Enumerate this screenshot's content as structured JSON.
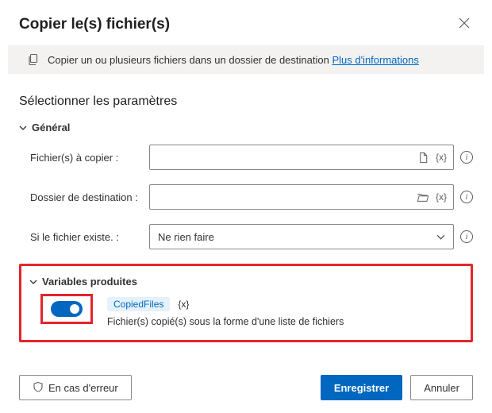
{
  "header": {
    "title": "Copier le(s) fichier(s)"
  },
  "banner": {
    "text": "Copier un ou plusieurs fichiers dans un dossier de destination ",
    "link": "Plus d'informations"
  },
  "section_title": "Sélectionner les paramètres",
  "general": {
    "label": "Général",
    "fields": {
      "files_to_copy_label": "Fichier(s) à copier :",
      "dest_folder_label": "Dossier de destination :",
      "if_exists_label": "Si le fichier existe. :",
      "if_exists_value": "Ne rien faire"
    },
    "fx_symbol": "{x}"
  },
  "variables": {
    "label": "Variables produites",
    "chip": "CopiedFiles",
    "fx_symbol": "{x}",
    "description": "Fichier(s) copié(s) sous la forme d'une liste de fichiers"
  },
  "footer": {
    "on_error": "En cas d'erreur",
    "save": "Enregistrer",
    "cancel": "Annuler"
  }
}
